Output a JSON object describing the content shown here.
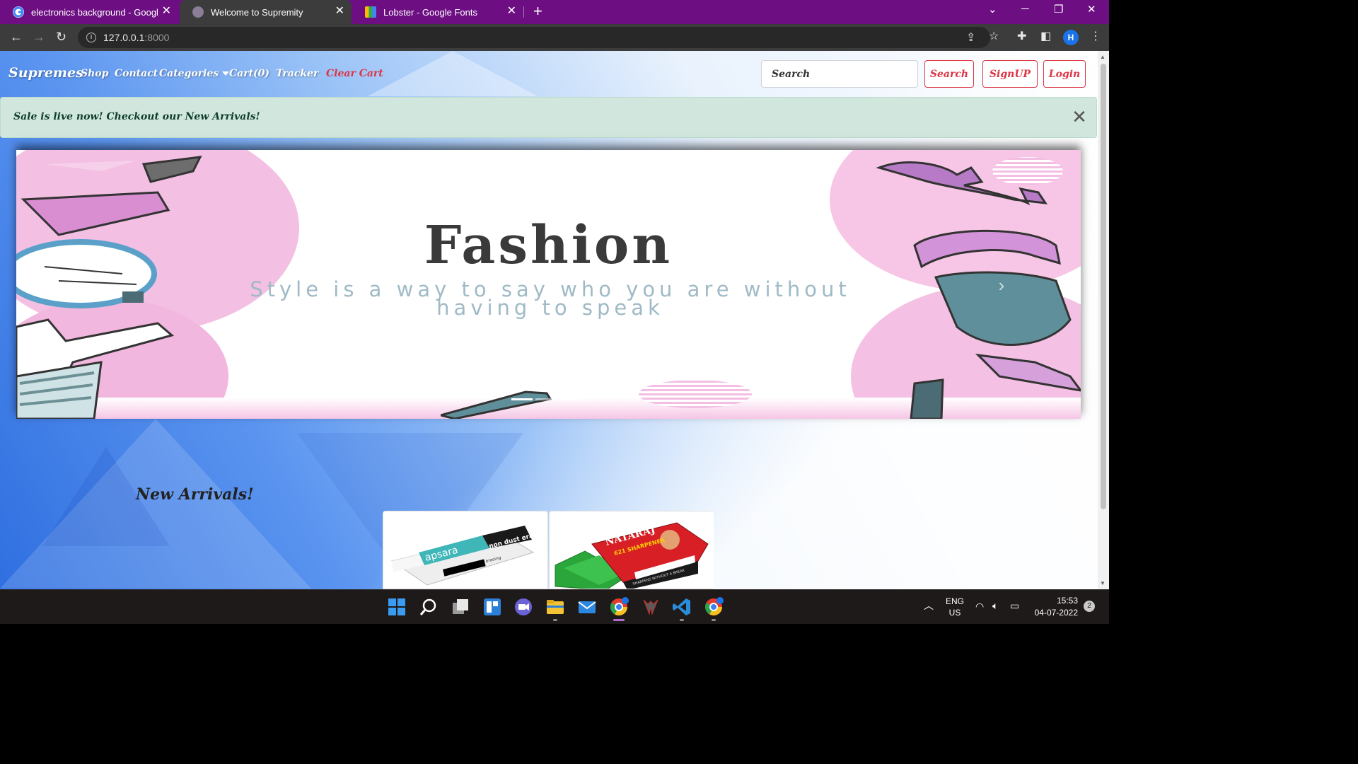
{
  "browser": {
    "tabs": [
      {
        "title": "electronics background - Google",
        "active": false
      },
      {
        "title": "Welcome to Supremity",
        "active": true
      },
      {
        "title": "Lobster - Google Fonts",
        "active": false
      }
    ],
    "address": {
      "host": "127.0.0.1",
      "port": ":8000"
    },
    "profile_initial": "H",
    "accent": "#6d0f82"
  },
  "navbar": {
    "brand": "Supremes",
    "links": [
      "Shop",
      "Contact",
      "Categories",
      "Cart(0)",
      "Tracker",
      "Clear Cart"
    ],
    "search_placeholder": "Search",
    "search_button": "Search",
    "signup_button": "SignUP",
    "login_button": "Login",
    "danger_color": "#dc3545"
  },
  "alert": {
    "message": "Sale is live now! Checkout our New Arrivals!",
    "close_glyph": "✕"
  },
  "carousel": {
    "title": "Fashion",
    "subtitle": "Style is a way to say who you are without having to speak",
    "slide_count": 3,
    "active_slide": 1
  },
  "arrivals": {
    "heading": "New Arrivals!",
    "products": [
      {
        "brand": "apsara",
        "tag": "non dust eraser",
        "sub": "for neat and clean erasing"
      },
      {
        "brand": "NATARAJ",
        "tag": "621 SHARPENER",
        "sub": "SHARPENS WITHOUT A BREAK"
      }
    ]
  },
  "taskbar": {
    "language": "ENG",
    "region": "US",
    "time": "15:53",
    "date": "04-07-2022",
    "notifications": "2"
  }
}
